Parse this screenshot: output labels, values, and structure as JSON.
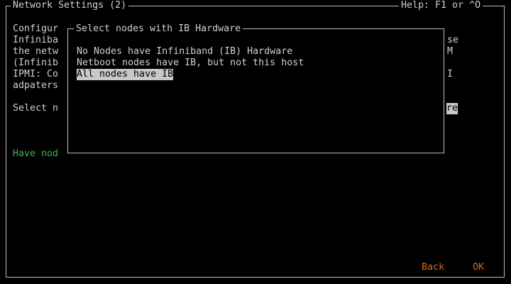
{
  "window": {
    "title": "Network Settings (2)",
    "help": "Help: F1 or ^O"
  },
  "background": {
    "lines": [
      "Configur",
      "Infiniba",
      "the netw",
      "(Infinib",
      "IPMI: Co",
      "adpaters"
    ],
    "right_fragments": {
      "r1": "se",
      "r2": "M",
      "r4": "I"
    },
    "select_prompt": "Select n",
    "select_highlight": "re",
    "status": "Have nod"
  },
  "dialog": {
    "title": "Select nodes with IB Hardware",
    "options": [
      "No Nodes have Infiniband (IB) Hardware",
      "Netboot nodes have IB, but not this host",
      "All nodes have IB"
    ],
    "selected_index": 2
  },
  "footer": {
    "back_label": "Back",
    "ok_label": "OK"
  },
  "colors": {
    "text": "#d0d0d0",
    "highlight_bg": "#c8c8c8",
    "status_green": "#3fb84a",
    "button_orange": "#d66a1c"
  }
}
